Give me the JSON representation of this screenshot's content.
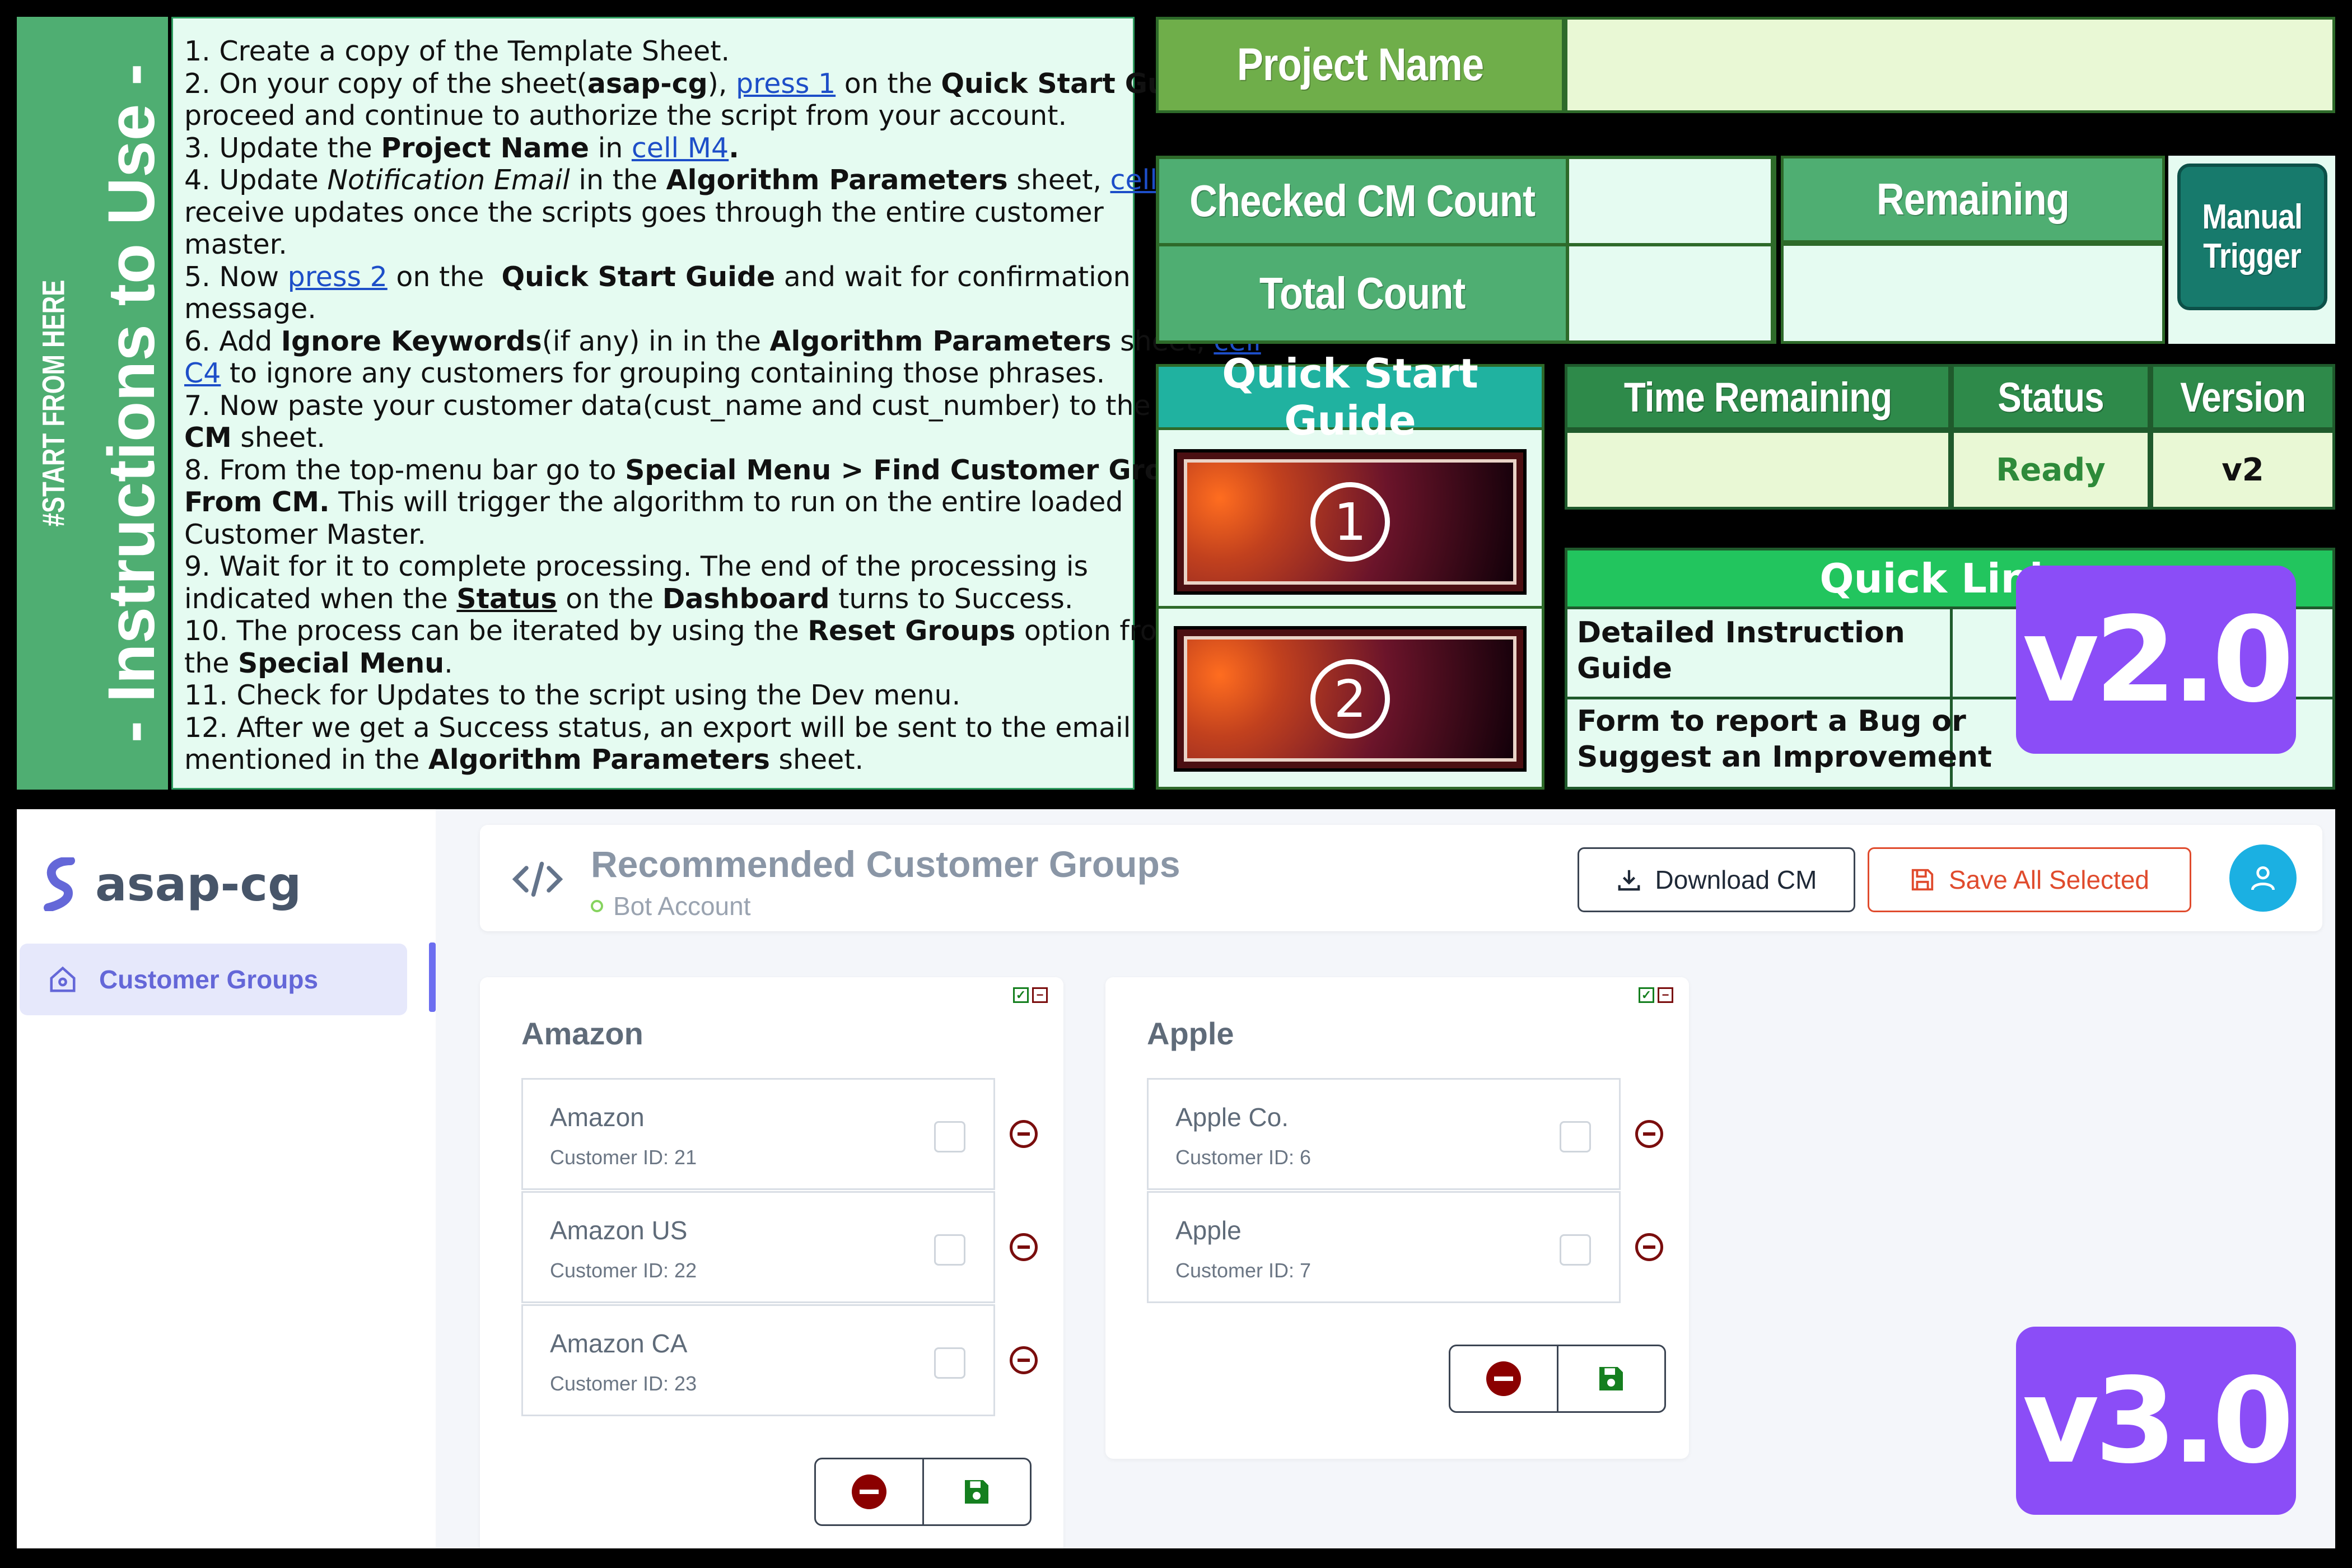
{
  "v2": {
    "side_title": "- Instructions to Use -",
    "side_subtitle": "#START FROM HERE",
    "project_name_label": "Project Name",
    "checked_label": "Checked CM Count",
    "remaining_label": "Remaining",
    "total_label": "Total Count",
    "manual_trigger": [
      "Manual",
      "Trigger"
    ],
    "qsg_title": "Quick Start Guide",
    "button1": "1",
    "button2": "2",
    "time_remaining_label": "Time Remaining",
    "status_label": "Status",
    "version_label": "Version",
    "status_value": "Ready",
    "version_value": "v2",
    "quick_links_title": "Quick Links",
    "link1": [
      "Detailed Instruction",
      "Guide"
    ],
    "link2": [
      "Form to report a Bug or",
      "Suggest an Improvement"
    ],
    "badge": "v2.0"
  },
  "v3": {
    "brand": "asap-cg",
    "nav_item": "Customer Groups",
    "page_title": "Recommended Customer Groups",
    "account": "Bot Account",
    "download_btn": "Download CM",
    "save_all_btn": "Save All Selected",
    "badge": "v3.0",
    "groups": [
      {
        "title": "Amazon",
        "items": [
          {
            "name": "Amazon",
            "id": "Customer ID: 21"
          },
          {
            "name": "Amazon US",
            "id": "Customer ID: 22"
          },
          {
            "name": "Amazon CA",
            "id": "Customer ID: 23"
          }
        ]
      },
      {
        "title": "Apple",
        "items": [
          {
            "name": "Apple Co.",
            "id": "Customer ID: 6"
          },
          {
            "name": "Apple",
            "id": "Customer ID: 7"
          }
        ]
      }
    ]
  },
  "colors": {
    "sheet_green": "#4fae72",
    "sheet_dark_green": "#2e8a4a",
    "teal": "#20b2a0",
    "quick_links_green": "#22c55e",
    "badge_purple": "#8b4df7",
    "accent_indigo": "#6467d8",
    "save_red": "#e04b2d"
  }
}
